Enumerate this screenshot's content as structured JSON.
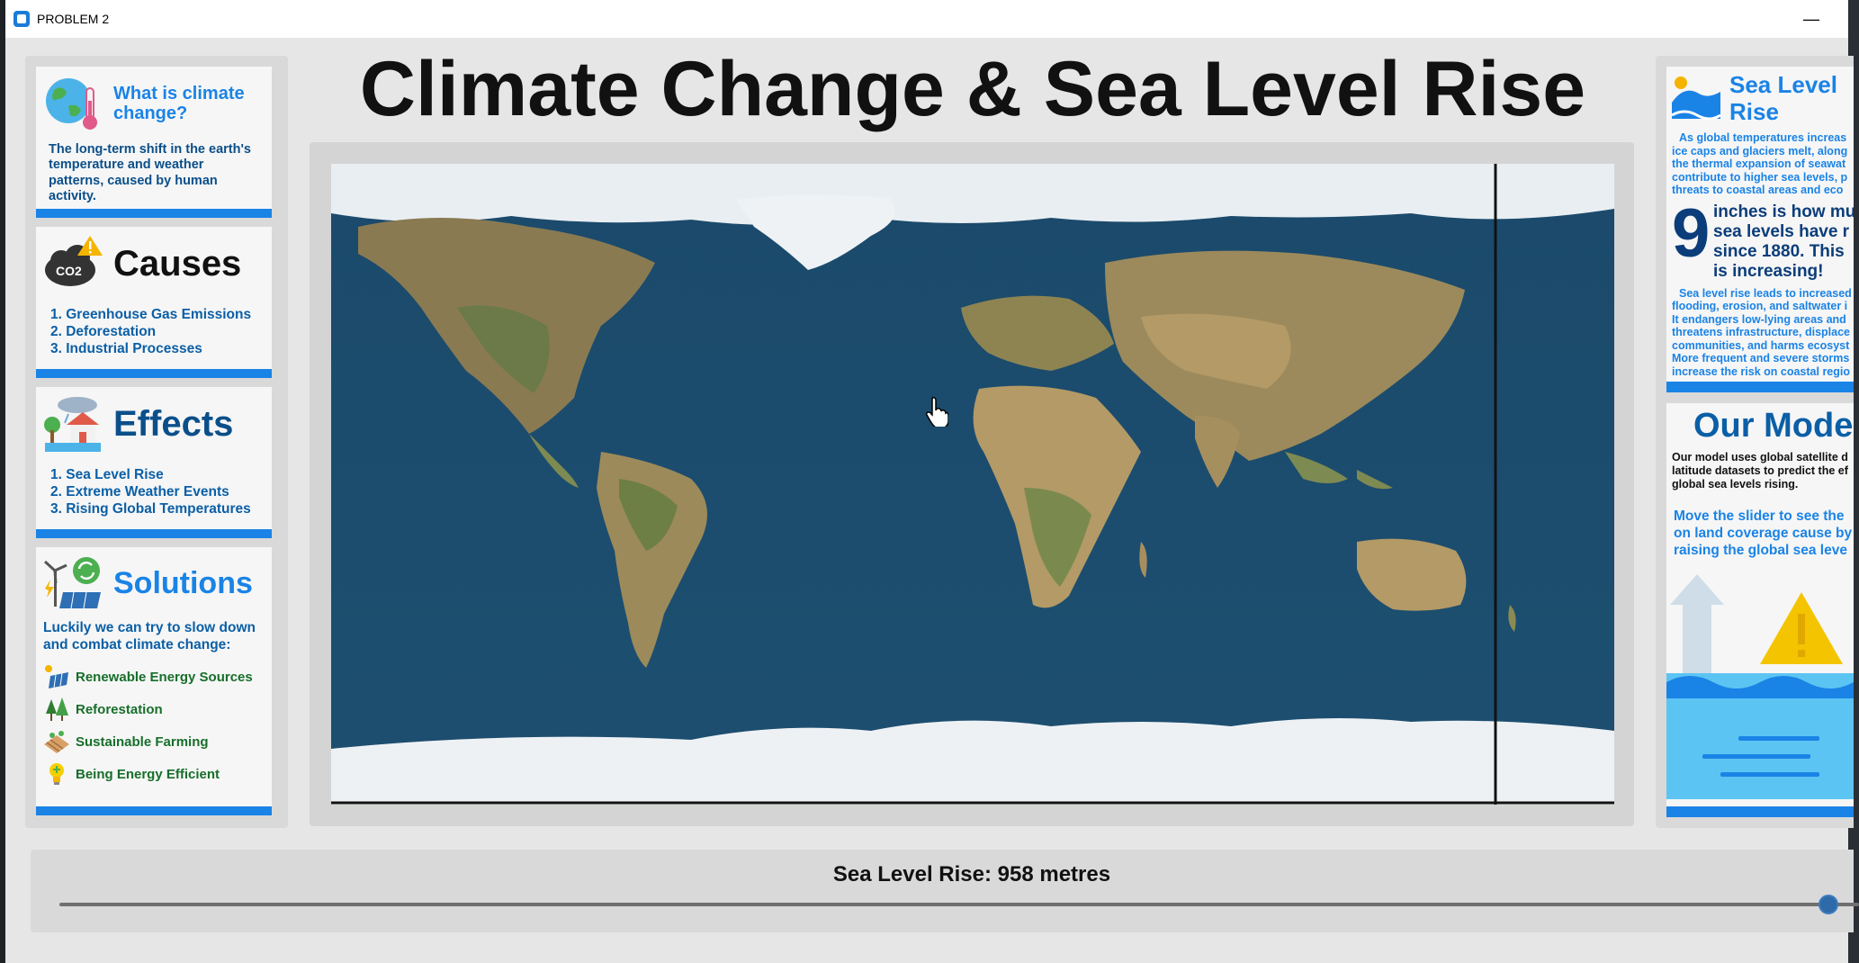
{
  "window": {
    "title": "PROBLEM 2",
    "minimize_glyph": "—"
  },
  "page_title": "Climate Change & Sea Level Rise",
  "left": {
    "what": {
      "title": "What is climate change?",
      "text": "The long-term shift in the earth's temperature and weather patterns, caused by human activity.",
      "icon": "earth-thermometer-icon"
    },
    "causes": {
      "title": "Causes",
      "icon": "co2-cloud-icon",
      "items": [
        "1. Greenhouse Gas Emissions",
        "2. Deforestation",
        "3. Industrial Processes"
      ]
    },
    "effects": {
      "title": "Effects",
      "icon": "flooded-house-icon",
      "items": [
        "1. Sea Level Rise",
        "2. Extreme Weather Events",
        "3. Rising Global Temperatures"
      ]
    },
    "solutions": {
      "title": "Solutions",
      "icon": "wind-solar-icon",
      "intro": "Luckily we can try to slow down and combat climate change:",
      "items": [
        {
          "label": "Renewable Energy Sources",
          "icon": "solar-panel-icon"
        },
        {
          "label": "Reforestation",
          "icon": "trees-icon"
        },
        {
          "label": "Sustainable Farming",
          "icon": "farm-field-icon"
        },
        {
          "label": "Being Energy Efficient",
          "icon": "lightbulb-icon"
        }
      ]
    }
  },
  "right": {
    "sea": {
      "title_lines": [
        "Sea Level",
        "Rise"
      ],
      "icon": "wave-sun-icon",
      "intro_lines": [
        "As global temperatures increas",
        "ice caps and glaciers melt, along",
        "the thermal expansion of seawat",
        "contribute to higher sea levels, p",
        "threats to coastal areas and eco"
      ],
      "stat_number": "9",
      "stat_lines": [
        "inches is how mu",
        "sea levels have r",
        "since 1880. This",
        "is increasing!"
      ],
      "effects_lines": [
        "Sea level rise leads to increased",
        "flooding, erosion, and saltwater i",
        "It endangers low-lying areas and",
        "threatens infrastructure, displace",
        "communities, and harms ecosyst",
        "More frequent and severe storms",
        "increase the risk on coastal regio"
      ]
    },
    "model": {
      "title": "Our Mode",
      "text_lines": [
        "Our model uses global satellite d",
        "latitude datasets to predict the ef",
        "global sea levels rising."
      ],
      "cta_lines": [
        "Move the slider to see the",
        "on land coverage cause by",
        "raising the global sea leve"
      ],
      "illustration": "rising-water-warning-icon"
    }
  },
  "map": {
    "description_icon": "world-map"
  },
  "slider": {
    "label": "Sea Level Rise: 958 metres",
    "fraction": 0.983
  },
  "colors": {
    "accent": "#1a83e6",
    "navy": "#0b4f8a",
    "ocean": "#1d4e6e",
    "ice": "#eef1f4",
    "land": "#b49a6a"
  }
}
